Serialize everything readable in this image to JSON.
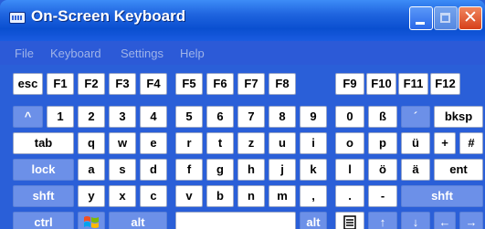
{
  "window": {
    "title": "On-Screen Keyboard",
    "buttons": {
      "minimize": "minimize",
      "maximize": "maximize",
      "close": "✕"
    }
  },
  "menu": [
    "File",
    "Keyboard",
    "Settings",
    "Help"
  ],
  "keyboard": {
    "function_row": [
      "esc",
      "F1",
      "F2",
      "F3",
      "F4",
      "F5",
      "F6",
      "F7",
      "F8",
      "F9",
      "F10",
      "F11",
      "F12"
    ],
    "number_row": [
      "^",
      "1",
      "2",
      "3",
      "4",
      "5",
      "6",
      "7",
      "8",
      "9",
      "0",
      "ß",
      "´",
      "bksp"
    ],
    "top_row": [
      "tab",
      "q",
      "w",
      "e",
      "r",
      "t",
      "z",
      "u",
      "i",
      "o",
      "p",
      "ü",
      "+",
      "#"
    ],
    "home_row": [
      "lock",
      "a",
      "s",
      "d",
      "f",
      "g",
      "h",
      "j",
      "k",
      "l",
      "ö",
      "ä",
      "ent"
    ],
    "bottom_row": [
      "shft",
      "y",
      "x",
      "c",
      "v",
      "b",
      "n",
      "m",
      ",",
      ".",
      "-",
      "shft"
    ],
    "space_row": [
      "ctrl",
      "windows-logo",
      "alt",
      "",
      "alt",
      "menu-icon",
      "↑",
      "↓",
      "←",
      "→"
    ],
    "colors": {
      "window_blue": "#2a5fd8",
      "key_face": "#ffffff",
      "mod_key": "#6c90e8"
    }
  }
}
